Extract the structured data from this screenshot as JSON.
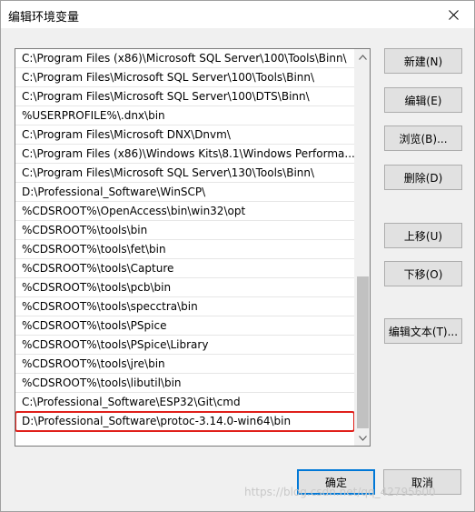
{
  "window": {
    "title": "编辑环境变量",
    "close_icon": "close-icon"
  },
  "path_list": {
    "items": [
      "C:\\Program Files (x86)\\Microsoft SQL Server\\100\\Tools\\Binn\\",
      "C:\\Program Files\\Microsoft SQL Server\\100\\Tools\\Binn\\",
      "C:\\Program Files\\Microsoft SQL Server\\100\\DTS\\Binn\\",
      "%USERPROFILE%\\.dnx\\bin",
      "C:\\Program Files\\Microsoft DNX\\Dnvm\\",
      "C:\\Program Files (x86)\\Windows Kits\\8.1\\Windows Performa...",
      "C:\\Program Files\\Microsoft SQL Server\\130\\Tools\\Binn\\",
      "D:\\Professional_Software\\WinSCP\\",
      "%CDSROOT%\\OpenAccess\\bin\\win32\\opt",
      "%CDSROOT%\\tools\\bin",
      "%CDSROOT%\\tools\\fet\\bin",
      "%CDSROOT%\\tools\\Capture",
      "%CDSROOT%\\tools\\pcb\\bin",
      "%CDSROOT%\\tools\\specctra\\bin",
      "%CDSROOT%\\tools\\PSpice",
      "%CDSROOT%\\tools\\PSpice\\Library",
      "%CDSROOT%\\tools\\jre\\bin",
      "%CDSROOT%\\tools\\libutil\\bin",
      "C:\\Professional_Software\\ESP32\\Git\\cmd",
      "D:\\Professional_Software\\protoc-3.14.0-win64\\bin"
    ],
    "highlight_color": "#e0201b"
  },
  "buttons": {
    "new": "新建(N)",
    "edit": "编辑(E)",
    "browse": "浏览(B)...",
    "delete": "删除(D)",
    "move_up": "上移(U)",
    "move_down": "下移(O)",
    "edit_text": "编辑文本(T)...",
    "ok": "确定",
    "cancel": "取消"
  },
  "watermark": "https://blog.csdn.net/qq_42795600"
}
